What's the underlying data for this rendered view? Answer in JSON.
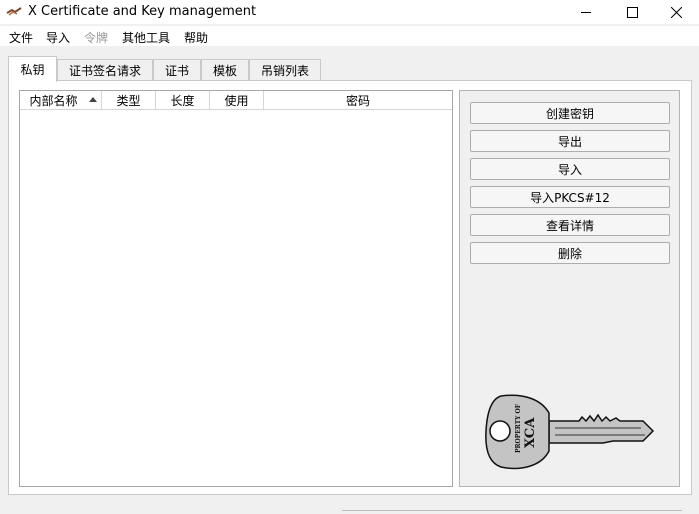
{
  "window": {
    "title": "X Certificate and Key management"
  },
  "menu": {
    "items": [
      {
        "label": "文件",
        "enabled": true
      },
      {
        "label": "导入",
        "enabled": true
      },
      {
        "label": "令牌",
        "enabled": false
      },
      {
        "label": "其他工具",
        "enabled": true
      },
      {
        "label": "帮助",
        "enabled": true
      }
    ]
  },
  "tabs": [
    {
      "label": "私钥",
      "active": true
    },
    {
      "label": "证书签名请求",
      "active": false
    },
    {
      "label": "证书",
      "active": false
    },
    {
      "label": "模板",
      "active": false
    },
    {
      "label": "吊销列表",
      "active": false
    }
  ],
  "table": {
    "columns": [
      "内部名称",
      "类型",
      "长度",
      "使用",
      "密码"
    ],
    "sort_column": "内部名称",
    "sort_direction": "ascending",
    "rows": []
  },
  "buttons": {
    "create_key": "创建密钥",
    "export": "导出",
    "import": "导入",
    "import_pkcs12": "导入PKCS#12",
    "details": "查看详情",
    "delete": "删除"
  },
  "key_image": {
    "line1": "PROPERTY OF",
    "line2": "XCA"
  },
  "colors": {
    "key_fill": "#c4c4c4",
    "window_bg": "#f0f0f0"
  }
}
